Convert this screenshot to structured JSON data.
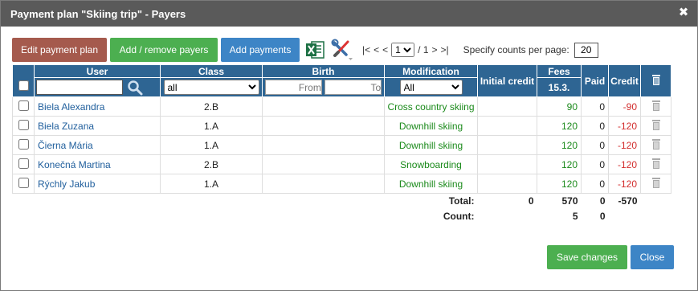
{
  "dialog": {
    "title": "Payment plan \"Skiing trip\" - Payers",
    "close_symbol": "✖"
  },
  "toolbar": {
    "edit_label": "Edit payment plan",
    "add_remove_label": "Add / remove payers",
    "add_payments_label": "Add payments",
    "pager": {
      "first": "|<",
      "prev2": "<",
      "prev": "<",
      "page": "1",
      "of": "/ 1",
      "next": ">",
      "next2": ">|",
      "page_options": [
        "1"
      ]
    },
    "per_page_label": "Specify counts per page:",
    "per_page_value": "20"
  },
  "table": {
    "headers": {
      "user": "User",
      "class": "Class",
      "birth": "Birth",
      "modification": "Modification",
      "initial_credit": "Initial credit",
      "fees": "Fees",
      "fees_date": "15.3.",
      "paid": "Paid",
      "credit": "Credit"
    },
    "filters": {
      "class_value": "all",
      "birth_from_placeholder": "From",
      "birth_to_placeholder": "To",
      "modification_value": "All"
    },
    "rows": [
      {
        "user": "Biela Alexandra",
        "class": "2.B",
        "modification": "Cross country skiing",
        "fees": "90",
        "paid": "0",
        "credit": "-90"
      },
      {
        "user": "Biela Zuzana",
        "class": "1.A",
        "modification": "Downhill skiing",
        "fees": "120",
        "paid": "0",
        "credit": "-120"
      },
      {
        "user": "Čierna Mária",
        "class": "1.A",
        "modification": "Downhill skiing",
        "fees": "120",
        "paid": "0",
        "credit": "-120"
      },
      {
        "user": "Konečná Martina",
        "class": "2.B",
        "modification": "Snowboarding",
        "fees": "120",
        "paid": "0",
        "credit": "-120"
      },
      {
        "user": "Rýchly Jakub",
        "class": "1.A",
        "modification": "Downhill skiing",
        "fees": "120",
        "paid": "0",
        "credit": "-120"
      }
    ],
    "totals": {
      "label": "Total:",
      "initial_credit": "0",
      "fees": "570",
      "paid": "0",
      "credit": "-570"
    },
    "count": {
      "label": "Count:",
      "fees": "5",
      "paid": "0"
    }
  },
  "footer": {
    "save_label": "Save changes",
    "close_label": "Close"
  },
  "colors": {
    "header_bg": "#2e6593",
    "green_btn": "#4caf50",
    "blue_btn": "#3d85c6",
    "brown_btn": "#a55a4d",
    "credit_red": "#d32f2f",
    "modification_green": "#1b8a1b"
  }
}
